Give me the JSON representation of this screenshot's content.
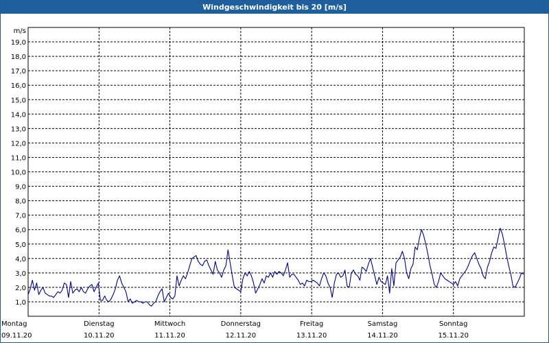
{
  "window": {
    "title": "Windgeschwindigkeit bis 20 [m/s]"
  },
  "chart_data": {
    "type": "line",
    "title": "Windgeschwindigkeit bis 20 [m/s]",
    "ylabel": "m/s",
    "ylim": [
      0,
      20
    ],
    "yticks": [
      "1,0",
      "2,0",
      "3,0",
      "4,0",
      "5,0",
      "6,0",
      "7,0",
      "8,0",
      "9,0",
      "10,0",
      "11,0",
      "12,0",
      "13,0",
      "14,0",
      "15,0",
      "16,0",
      "17,0",
      "18,0",
      "19,0"
    ],
    "xlim": [
      0,
      7
    ],
    "xticks": [
      {
        "day": "Montag",
        "date": "09.11.20"
      },
      {
        "day": "Dienstag",
        "date": "10.11.20"
      },
      {
        "day": "Mittwoch",
        "date": "11.11.20"
      },
      {
        "day": "Donnerstag",
        "date": "12.11.20"
      },
      {
        "day": "Freitag",
        "date": "13.11.20"
      },
      {
        "day": "Samstag",
        "date": "14.11.20"
      },
      {
        "day": "Sonntag",
        "date": "15.11.20"
      }
    ],
    "grid": true,
    "series_color": "#00008b",
    "series": [
      {
        "x": [
          0,
          0.03,
          0.06,
          0.09,
          0.12,
          0.15,
          0.18,
          0.21,
          0.24,
          0.27,
          0.3,
          0.33,
          0.36,
          0.39,
          0.42,
          0.45,
          0.48,
          0.51,
          0.54,
          0.57,
          0.6,
          0.63,
          0.66,
          0.69,
          0.72,
          0.75,
          0.78,
          0.81,
          0.84,
          0.87,
          0.9,
          0.93,
          0.96,
          0.99,
          1.02,
          1.05,
          1.08,
          1.11,
          1.14,
          1.17,
          1.2,
          1.23,
          1.26,
          1.29,
          1.32,
          1.35,
          1.38,
          1.41,
          1.44,
          1.47,
          1.5,
          1.53,
          1.56,
          1.59,
          1.62,
          1.65,
          1.68,
          1.71,
          1.74,
          1.77,
          1.8,
          1.83,
          1.86,
          1.89,
          1.92,
          1.95,
          1.98,
          2.01,
          2.04,
          2.07,
          2.1,
          2.13,
          2.16,
          2.19,
          2.22,
          2.25,
          2.28,
          2.31,
          2.34,
          2.37,
          2.4,
          2.43,
          2.46,
          2.49,
          2.52,
          2.55,
          2.58,
          2.61,
          2.64,
          2.67,
          2.7,
          2.73,
          2.76,
          2.79,
          2.82,
          2.85,
          2.88,
          2.91,
          2.94,
          2.97,
          3.0,
          3.03,
          3.06,
          3.09,
          3.12,
          3.15,
          3.18,
          3.21,
          3.24,
          3.27,
          3.3,
          3.33,
          3.36,
          3.39,
          3.42,
          3.45,
          3.48,
          3.51,
          3.54,
          3.57,
          3.6,
          3.63,
          3.66,
          3.69,
          3.72,
          3.75,
          3.78,
          3.81,
          3.84,
          3.87,
          3.9,
          3.93,
          3.96,
          3.99,
          4.02,
          4.05,
          4.08,
          4.11,
          4.14,
          4.17,
          4.2,
          4.23,
          4.26,
          4.29,
          4.32,
          4.35,
          4.38,
          4.41,
          4.44,
          4.47,
          4.5,
          4.53,
          4.56,
          4.59,
          4.62,
          4.65,
          4.68,
          4.71,
          4.74,
          4.77,
          4.8,
          4.83,
          4.86,
          4.89,
          4.92,
          4.95,
          4.98,
          5.01,
          5.04,
          5.07,
          5.1,
          5.13,
          5.16,
          5.19,
          5.22,
          5.25,
          5.28,
          5.31,
          5.34,
          5.37,
          5.4,
          5.43,
          5.46,
          5.49,
          5.52,
          5.55,
          5.58,
          5.61,
          5.64,
          5.67,
          5.7,
          5.73,
          5.76,
          5.79,
          5.82,
          5.85,
          5.88,
          5.91,
          5.94,
          5.97,
          6.0,
          6.03,
          6.06,
          6.09,
          6.12,
          6.15,
          6.18,
          6.21,
          6.24,
          6.27,
          6.3,
          6.33,
          6.36,
          6.39,
          6.42,
          6.45,
          6.48,
          6.51,
          6.54,
          6.57,
          6.6,
          6.63,
          6.66,
          6.69,
          6.72,
          6.75,
          6.78,
          6.81,
          6.84,
          6.87,
          6.9,
          6.93,
          6.96,
          6.99
        ],
        "values": [
          1.5,
          1.9,
          2.5,
          1.8,
          2.3,
          1.5,
          1.8,
          2.0,
          1.6,
          1.5,
          1.4,
          1.4,
          1.3,
          1.5,
          1.7,
          1.6,
          1.8,
          2.3,
          2.2,
          1.3,
          2.4,
          1.6,
          1.8,
          1.9,
          1.7,
          2.0,
          1.7,
          1.6,
          1.9,
          2.1,
          2.2,
          1.7,
          2.0,
          2.3,
          1.1,
          1.1,
          1.4,
          1.1,
          1.0,
          1.2,
          1.5,
          1.9,
          2.5,
          2.8,
          2.3,
          2.0,
          1.7,
          1.0,
          1.2,
          0.9,
          1.0,
          1.1,
          1.0,
          1.0,
          0.9,
          1.0,
          1.0,
          0.8,
          0.7,
          0.9,
          1.0,
          1.4,
          1.7,
          1.9,
          1.0,
          1.3,
          1.6,
          1.3,
          1.2,
          1.4,
          2.8,
          2.1,
          2.5,
          2.8,
          2.6,
          3.0,
          3.5,
          4.0,
          4.1,
          4.2,
          3.8,
          3.6,
          3.5,
          3.8,
          3.9,
          3.5,
          3.2,
          2.9,
          3.8,
          3.2,
          3.0,
          2.7,
          3.2,
          3.5,
          4.6,
          3.7,
          2.8,
          2.0,
          1.9,
          1.8,
          1.7,
          2.6,
          3.0,
          2.8,
          3.1,
          2.8,
          2.3,
          1.6,
          1.9,
          2.2,
          2.6,
          2.3,
          2.8,
          2.7,
          3.0,
          2.7,
          3.1,
          2.9,
          3.1,
          3.0,
          2.8,
          3.2,
          3.7,
          2.7,
          2.9,
          2.9,
          2.7,
          2.5,
          2.2,
          2.3,
          2.1,
          2.5,
          2.4,
          2.4,
          2.5,
          2.4,
          2.3,
          2.1,
          2.6,
          3.0,
          2.8,
          2.3,
          2.0,
          1.3,
          2.3,
          2.9,
          3.0,
          2.7,
          2.8,
          3.2,
          2.1,
          2.0,
          3.0,
          3.2,
          2.9,
          2.8,
          2.5,
          3.4,
          3.3,
          3.1,
          3.6,
          4.0,
          3.4,
          2.8,
          2.2,
          2.7,
          2.4,
          2.3,
          2.2,
          2.8,
          1.6,
          3.3,
          2.1,
          3.7,
          3.9,
          4.1,
          4.5,
          4.0,
          3.0,
          2.6,
          3.3,
          3.6,
          4.8,
          4.6,
          5.4,
          6.0,
          5.6,
          5.0,
          4.3,
          3.5,
          2.9,
          2.2,
          2.0,
          2.4,
          3.0,
          2.8,
          2.6,
          2.5,
          2.4,
          2.3,
          2.2,
          2.4,
          2.1,
          2.6,
          2.8,
          3.0,
          3.2,
          3.5,
          3.9,
          4.2,
          4.4,
          4.0,
          3.6,
          3.3,
          2.8,
          2.6,
          3.4,
          3.8,
          4.4,
          4.8,
          4.7,
          5.4,
          6.1,
          5.7,
          5.0,
          4.2,
          3.5,
          2.9,
          2.1,
          2.0,
          2.3,
          2.6,
          3.0,
          2.9
        ]
      }
    ]
  }
}
